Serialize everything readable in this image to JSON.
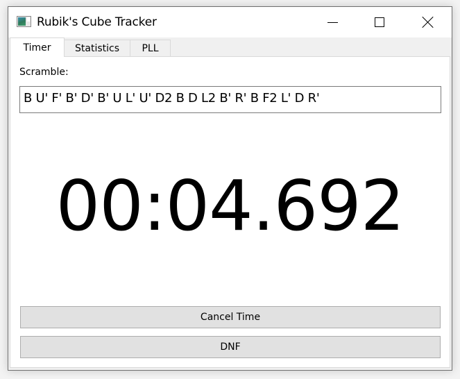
{
  "window": {
    "title": "Rubik's Cube Tracker",
    "app_icon": "app-window-icon",
    "controls": {
      "minimize": "minimize-icon",
      "maximize": "maximize-icon",
      "close": "close-icon"
    }
  },
  "tabs": [
    {
      "label": "Timer",
      "active": true
    },
    {
      "label": "Statistics",
      "active": false
    },
    {
      "label": "PLL",
      "active": false
    }
  ],
  "timer_tab": {
    "scramble_label": "Scramble:",
    "scramble_value": "B U' F' B' D' B' U L' U' D2 B D L2 B' R' B F2 L' D R'",
    "time_display": "00:04.692",
    "buttons": {
      "cancel_time": "Cancel Time",
      "dnf": "DNF"
    }
  }
}
